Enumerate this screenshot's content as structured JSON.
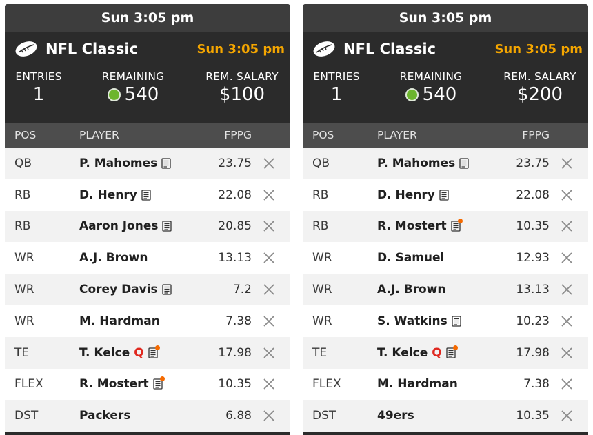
{
  "panels": [
    {
      "game_time": "Sun 3:05 pm",
      "contest_name": "NFL Classic",
      "contest_time": "Sun 3:05 pm",
      "entries_label": "ENTRIES",
      "entries_value": "1",
      "remaining_label": "REMAINING",
      "remaining_value": "540",
      "salary_label": "REM. SALARY",
      "salary_value": "$100",
      "col_pos": "POS",
      "col_player": "PLAYER",
      "col_fppg": "FPPG",
      "rows": [
        {
          "pos": "QB",
          "player": "P. Mahomes",
          "fppg": "23.75",
          "status": "",
          "news": true,
          "news_alert": false
        },
        {
          "pos": "RB",
          "player": "D. Henry",
          "fppg": "22.08",
          "status": "",
          "news": true,
          "news_alert": false
        },
        {
          "pos": "RB",
          "player": "Aaron Jones",
          "fppg": "20.85",
          "status": "",
          "news": true,
          "news_alert": false
        },
        {
          "pos": "WR",
          "player": "A.J. Brown",
          "fppg": "13.13",
          "status": "",
          "news": false,
          "news_alert": false
        },
        {
          "pos": "WR",
          "player": "Corey Davis",
          "fppg": "7.2",
          "status": "",
          "news": true,
          "news_alert": false
        },
        {
          "pos": "WR",
          "player": "M. Hardman",
          "fppg": "7.38",
          "status": "",
          "news": false,
          "news_alert": false
        },
        {
          "pos": "TE",
          "player": "T. Kelce",
          "fppg": "17.98",
          "status": "Q",
          "news": true,
          "news_alert": true
        },
        {
          "pos": "FLEX",
          "player": "R. Mostert",
          "fppg": "10.35",
          "status": "",
          "news": true,
          "news_alert": true
        },
        {
          "pos": "DST",
          "player": "Packers",
          "fppg": "6.88",
          "status": "",
          "news": false,
          "news_alert": false
        }
      ]
    },
    {
      "game_time": "Sun 3:05 pm",
      "contest_name": "NFL Classic",
      "contest_time": "Sun 3:05 pm",
      "entries_label": "ENTRIES",
      "entries_value": "1",
      "remaining_label": "REMAINING",
      "remaining_value": "540",
      "salary_label": "REM. SALARY",
      "salary_value": "$200",
      "col_pos": "POS",
      "col_player": "PLAYER",
      "col_fppg": "FPPG",
      "rows": [
        {
          "pos": "QB",
          "player": "P. Mahomes",
          "fppg": "23.75",
          "status": "",
          "news": true,
          "news_alert": false
        },
        {
          "pos": "RB",
          "player": "D. Henry",
          "fppg": "22.08",
          "status": "",
          "news": true,
          "news_alert": false
        },
        {
          "pos": "RB",
          "player": "R. Mostert",
          "fppg": "10.35",
          "status": "",
          "news": true,
          "news_alert": true
        },
        {
          "pos": "WR",
          "player": "D. Samuel",
          "fppg": "12.93",
          "status": "",
          "news": false,
          "news_alert": false
        },
        {
          "pos": "WR",
          "player": "A.J. Brown",
          "fppg": "13.13",
          "status": "",
          "news": false,
          "news_alert": false
        },
        {
          "pos": "WR",
          "player": "S. Watkins",
          "fppg": "10.23",
          "status": "",
          "news": true,
          "news_alert": false
        },
        {
          "pos": "TE",
          "player": "T. Kelce",
          "fppg": "17.98",
          "status": "Q",
          "news": true,
          "news_alert": true
        },
        {
          "pos": "FLEX",
          "player": "M. Hardman",
          "fppg": "7.38",
          "status": "",
          "news": false,
          "news_alert": false
        },
        {
          "pos": "DST",
          "player": "49ers",
          "fppg": "10.35",
          "status": "",
          "news": false,
          "news_alert": false
        }
      ]
    }
  ],
  "icons": {
    "contest": "football-icon",
    "remaining": "green-dot-icon",
    "news": "news-icon",
    "remove": "close-icon"
  },
  "colors": {
    "accent_time": "#f5a600",
    "status_q": "#e0281f",
    "news_alert": "#f56a00",
    "remaining_dot": "#6cb52d"
  }
}
